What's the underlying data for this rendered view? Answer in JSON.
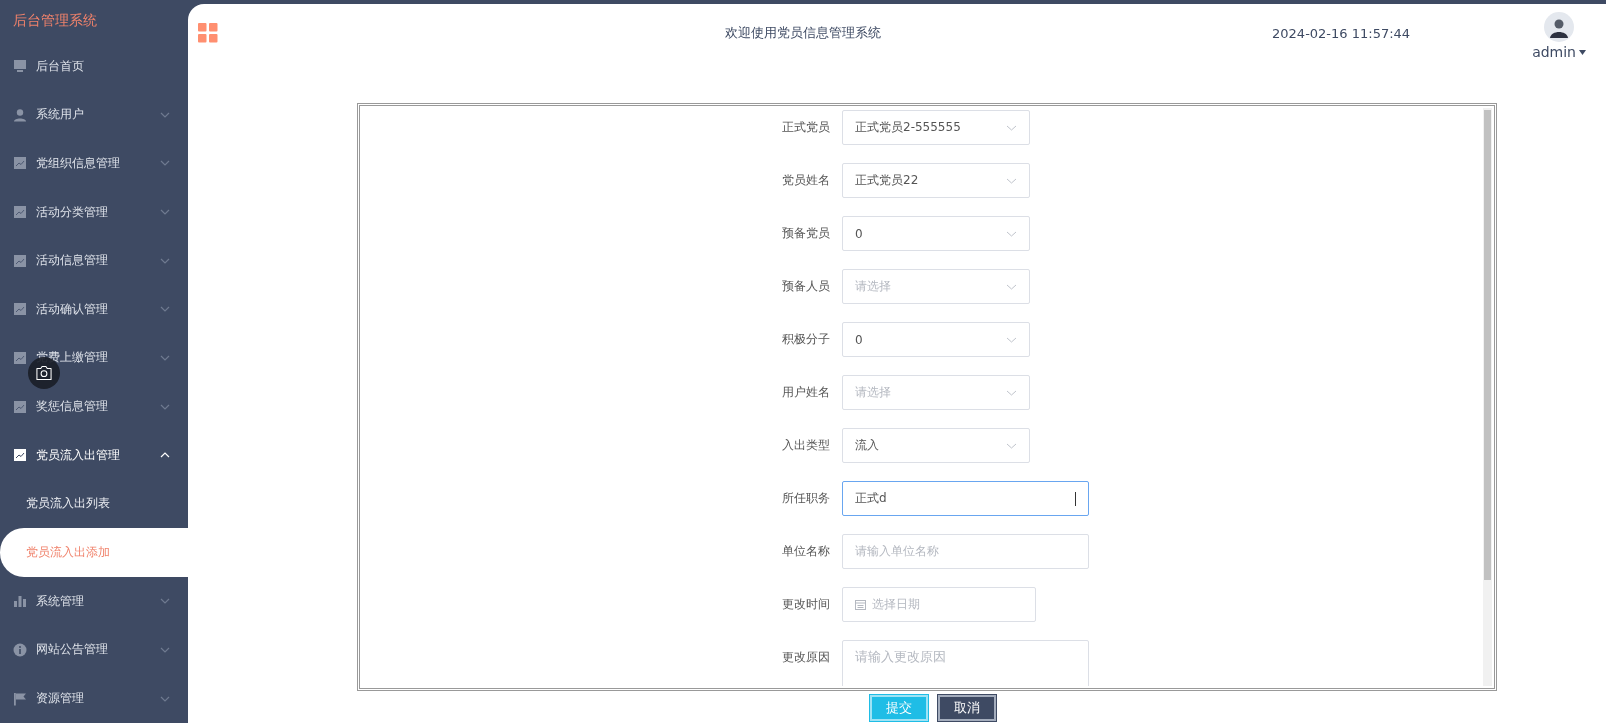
{
  "sidebar": {
    "title": "后台管理系统",
    "items": [
      {
        "label": "后台首页",
        "kind": "link"
      },
      {
        "label": "系统用户",
        "kind": "menu",
        "expanded": false
      },
      {
        "label": "党组织信息管理",
        "kind": "menu",
        "expanded": false
      },
      {
        "label": "活动分类管理",
        "kind": "menu",
        "expanded": false
      },
      {
        "label": "活动信息管理",
        "kind": "menu",
        "expanded": false
      },
      {
        "label": "活动确认管理",
        "kind": "menu",
        "expanded": false
      },
      {
        "label": "党费上缴管理",
        "kind": "menu",
        "expanded": false
      },
      {
        "label": "奖惩信息管理",
        "kind": "menu",
        "expanded": false
      },
      {
        "label": "党员流入出管理",
        "kind": "menu",
        "expanded": true,
        "children": [
          {
            "label": "党员流入出列表",
            "selected": false
          },
          {
            "label": "党员流入出添加",
            "selected": true
          }
        ]
      },
      {
        "label": "系统管理",
        "kind": "menu",
        "expanded": false
      },
      {
        "label": "网站公告管理",
        "kind": "menu",
        "expanded": false
      },
      {
        "label": "资源管理",
        "kind": "menu",
        "expanded": false
      }
    ]
  },
  "header": {
    "title": "欢迎使用党员信息管理系统",
    "datetime": "2024-02-16 11:57:44",
    "user": "admin"
  },
  "form": {
    "fields": [
      {
        "label": "正式党员",
        "kind": "select",
        "value": "正式党员2-555555",
        "focused": false
      },
      {
        "label": "党员姓名",
        "kind": "select",
        "value": "正式党员22",
        "focused": false
      },
      {
        "label": "预备党员",
        "kind": "select",
        "value": "0",
        "focused": false
      },
      {
        "label": "预备人员",
        "kind": "select",
        "placeholder": "请选择",
        "focused": false
      },
      {
        "label": "积极分子",
        "kind": "select",
        "value": "0",
        "focused": false
      },
      {
        "label": "用户姓名",
        "kind": "select",
        "placeholder": "请选择",
        "focused": false
      },
      {
        "label": "入出类型",
        "kind": "select",
        "value": "流入",
        "focused": false
      },
      {
        "label": "所任职务",
        "kind": "input",
        "value": "正式d",
        "focused": true
      },
      {
        "label": "单位名称",
        "kind": "input",
        "placeholder": "请输入单位名称",
        "focused": false
      },
      {
        "label": "更改时间",
        "kind": "date",
        "placeholder": "选择日期",
        "focused": false
      },
      {
        "label": "更改原因",
        "kind": "textarea",
        "placeholder": "请输入更改原因",
        "focused": false
      }
    ],
    "buttons": [
      {
        "label": "提交",
        "kind": "primary"
      },
      {
        "label": "取消",
        "kind": "secondary"
      }
    ]
  }
}
